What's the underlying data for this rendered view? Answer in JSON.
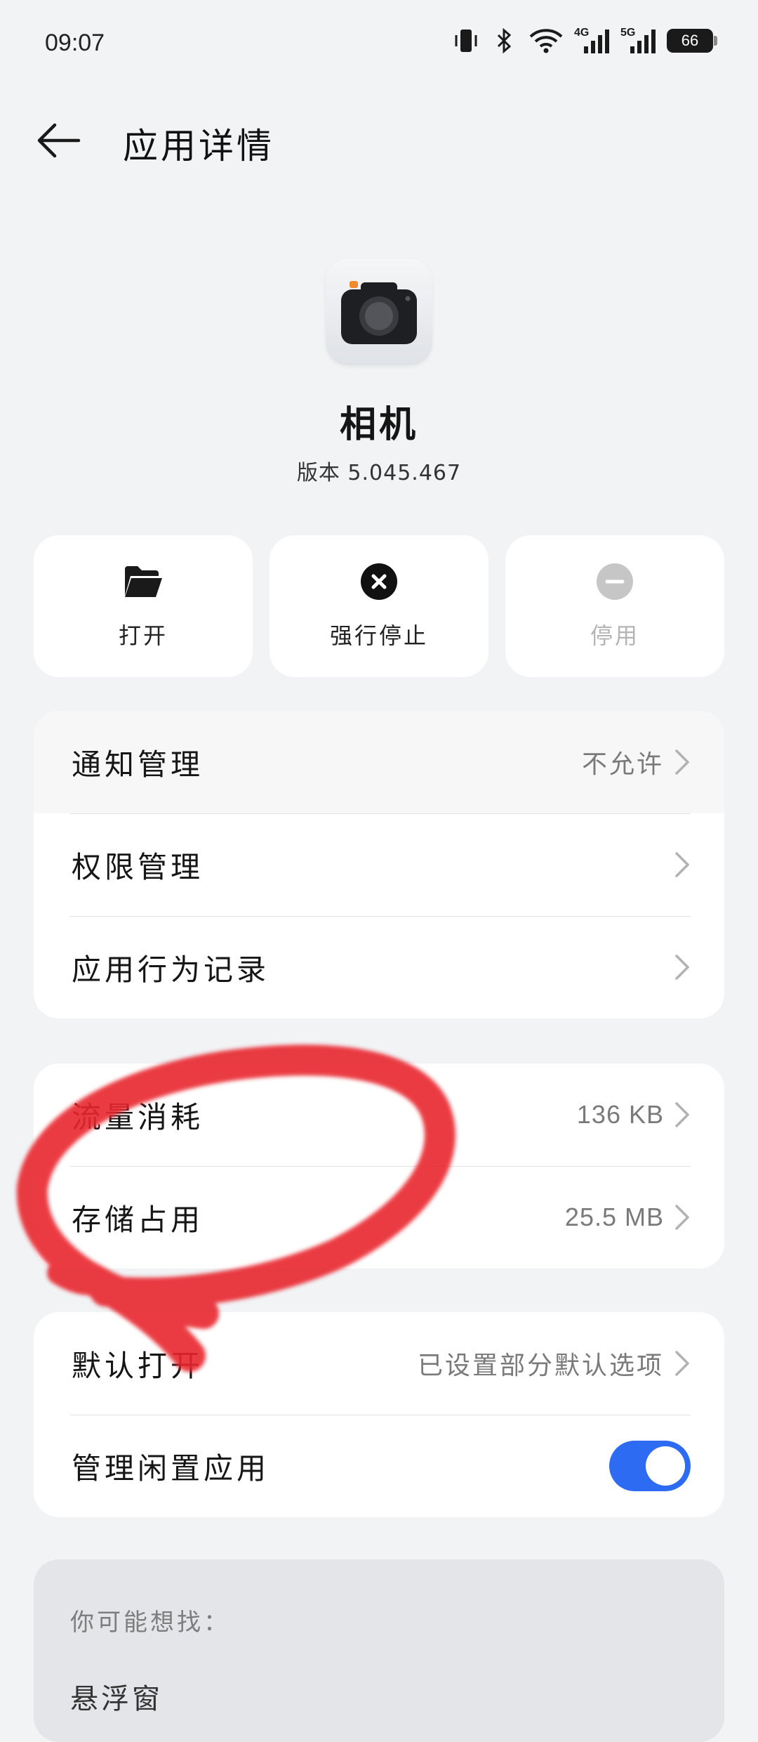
{
  "status_bar": {
    "time": "09:07",
    "battery": "66",
    "icons": [
      "vibrate-icon",
      "bluetooth-icon",
      "wifi-icon",
      "signal-4g-icon",
      "signal-5g-icon",
      "battery-icon"
    ],
    "net_4g": "4G",
    "net_5g": "5G"
  },
  "header": {
    "title": "应用详情",
    "back_icon": "back-arrow-icon"
  },
  "app": {
    "name": "相机",
    "version": "版本 5.045.467",
    "icon": "camera-icon"
  },
  "actions": [
    {
      "label": "打开",
      "icon": "folder-open-icon",
      "enabled": true
    },
    {
      "label": "强行停止",
      "icon": "close-circle-icon",
      "enabled": true
    },
    {
      "label": "停用",
      "icon": "minus-circle-icon",
      "enabled": false
    }
  ],
  "group1": [
    {
      "label": "通知管理",
      "value": "不允许"
    },
    {
      "label": "权限管理",
      "value": ""
    },
    {
      "label": "应用行为记录",
      "value": ""
    }
  ],
  "group2": [
    {
      "label": "流量消耗",
      "value": "136 KB"
    },
    {
      "label": "存储占用",
      "value": "25.5 MB"
    }
  ],
  "group3": {
    "default_open": {
      "label": "默认打开",
      "value": "已设置部分默认选项"
    },
    "manage_idle": {
      "label": "管理闲置应用",
      "toggle_on": true
    }
  },
  "suggestions": {
    "title": "你可能想找：",
    "first_item": "悬浮窗"
  },
  "colors": {
    "accent": "#2d6bf2",
    "background": "#f1f3f5",
    "annotation_red": "#e8262e"
  }
}
